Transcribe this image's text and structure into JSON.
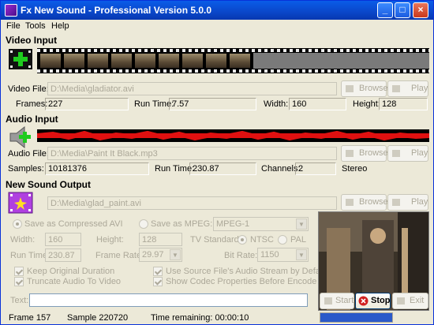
{
  "window": {
    "title": "Fx New Sound - Professional Version 5.0.0"
  },
  "menu": {
    "file": "File",
    "tools": "Tools",
    "help": "Help"
  },
  "video_input": {
    "heading": "Video Input",
    "file_label": "Video File:",
    "file_value": "D:\\Media\\gladiator.avi",
    "browse": "Browse",
    "play": "Play",
    "frames_label": "Frames:",
    "frames_value": "227",
    "runtime_label": "Run Time:",
    "runtime_value": "7.57",
    "width_label": "Width:",
    "width_value": "160",
    "height_label": "Height:",
    "height_value": "128"
  },
  "audio_input": {
    "heading": "Audio Input",
    "file_label": "Audio File:",
    "file_value": "D:\\Media\\Paint It Black.mp3",
    "browse": "Browse",
    "play": "Play",
    "samples_label": "Samples:",
    "samples_value": "10181376",
    "runtime_label": "Run Time:",
    "runtime_value": "230.87",
    "channels_label": "Channels:",
    "channels_value": "2",
    "channel_mode": "Stereo"
  },
  "output": {
    "heading": "New Sound Output",
    "file_value": "D:\\Media\\glad_paint.avi",
    "browse": "Browse",
    "play": "Play",
    "opt_avi": "Save as Compressed AVI",
    "opt_mpeg": "Save as MPEG:",
    "mpeg_type": "MPEG-1",
    "width_label": "Width:",
    "width_value": "160",
    "height_label": "Height:",
    "height_value": "128",
    "tv_label": "TV Standard:",
    "ntsc": "NTSC",
    "pal": "PAL",
    "runtime_label": "Run Time:",
    "runtime_value": "230.87",
    "framerate_label": "Frame Rate:",
    "framerate_value": "29.97",
    "bitrate_label": "Bit Rate:",
    "bitrate_value": "1150",
    "keep_duration": "Keep Original Duration",
    "truncate_audio": "Truncate Audio To Video",
    "use_source_audio": "Use Source File's Audio Stream by Default",
    "show_codec": "Show Codec Properties Before Encode",
    "text_label": "Text:",
    "text_value": "",
    "start": "Start",
    "stop": "Stop",
    "exit": "Exit"
  },
  "status": {
    "frame": "Frame 157",
    "sample": "Sample 220720",
    "time_remaining": "Time remaining: 00:00:10",
    "progress": 1.0
  },
  "colors": {
    "title_bar": "#0a47c9",
    "waveform": "#e01010",
    "progress": "#2a59c9",
    "film_icon_cross": "#1fcc1f",
    "output_icon": "#b040e0"
  }
}
